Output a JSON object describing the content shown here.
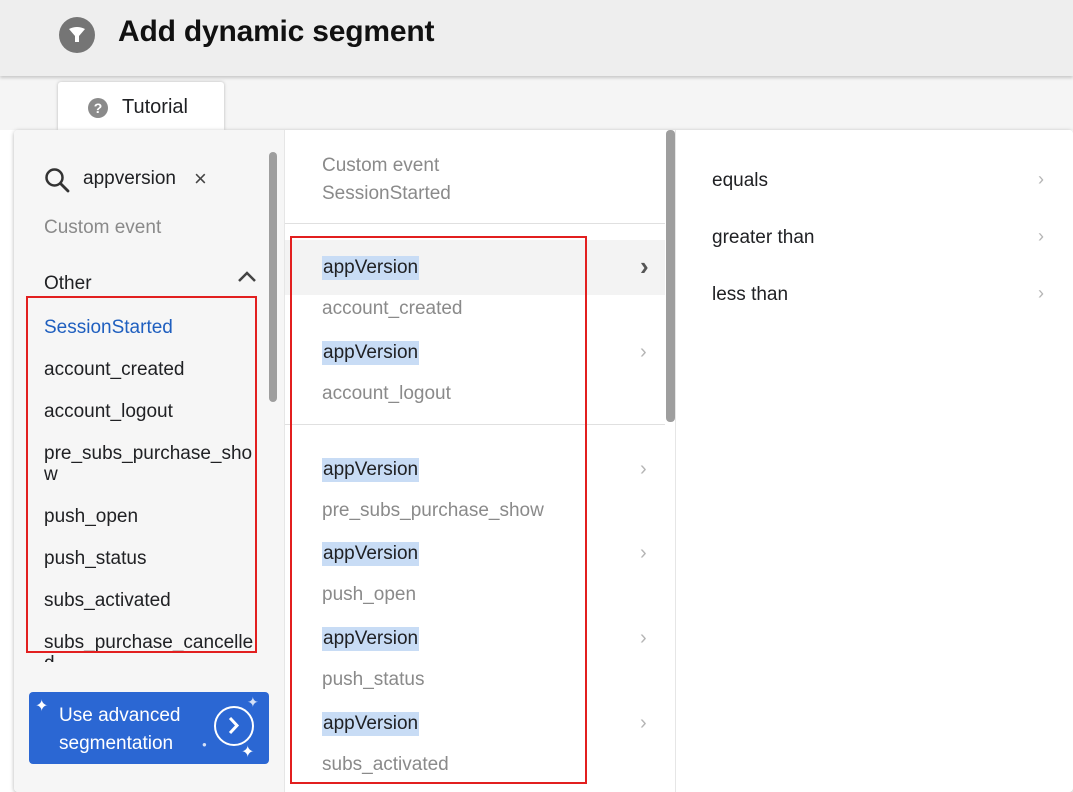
{
  "header": {
    "title": "Add dynamic segment",
    "icon": "funnel-icon"
  },
  "tabs": [
    {
      "label": "Tutorial",
      "icon": "help-circle-icon"
    }
  ],
  "event_column": {
    "search": {
      "value": "appversion",
      "icon": "search-icon",
      "clear_icon": "close-icon"
    },
    "category": "Custom event",
    "group": {
      "label": "Other",
      "expanded_icon": "chevron-up-icon"
    },
    "items": [
      "SessionStarted",
      "account_created",
      "account_logout",
      "pre_subs_purchase_show",
      "push_open",
      "push_status",
      "subs_activated",
      "subs_purchase_cancelled"
    ],
    "selected_index": 0,
    "advanced_button": {
      "label": "Use advanced segmentation",
      "icon": "chevron-right-circle-icon"
    }
  },
  "property_column": {
    "header": [
      "Custom event",
      "SessionStarted"
    ],
    "rows": [
      {
        "label": "appVersion",
        "event": "account_created"
      },
      {
        "label": "appVersion",
        "event": "account_logout"
      },
      {
        "label": "appVersion",
        "event": "pre_subs_purchase_show"
      },
      {
        "label": "appVersion",
        "event": "push_open"
      },
      {
        "label": "appVersion",
        "event": "push_status"
      },
      {
        "label": "appVersion",
        "event": "subs_activated"
      }
    ],
    "highlight_color": "#c8dcf5"
  },
  "operator_column": {
    "items": [
      "equals",
      "greater than",
      "less than"
    ]
  },
  "colors": {
    "selected_text": "#1f5fbf",
    "advanced_button_bg": "#2b67d3",
    "annotation": "#e21f1f"
  }
}
